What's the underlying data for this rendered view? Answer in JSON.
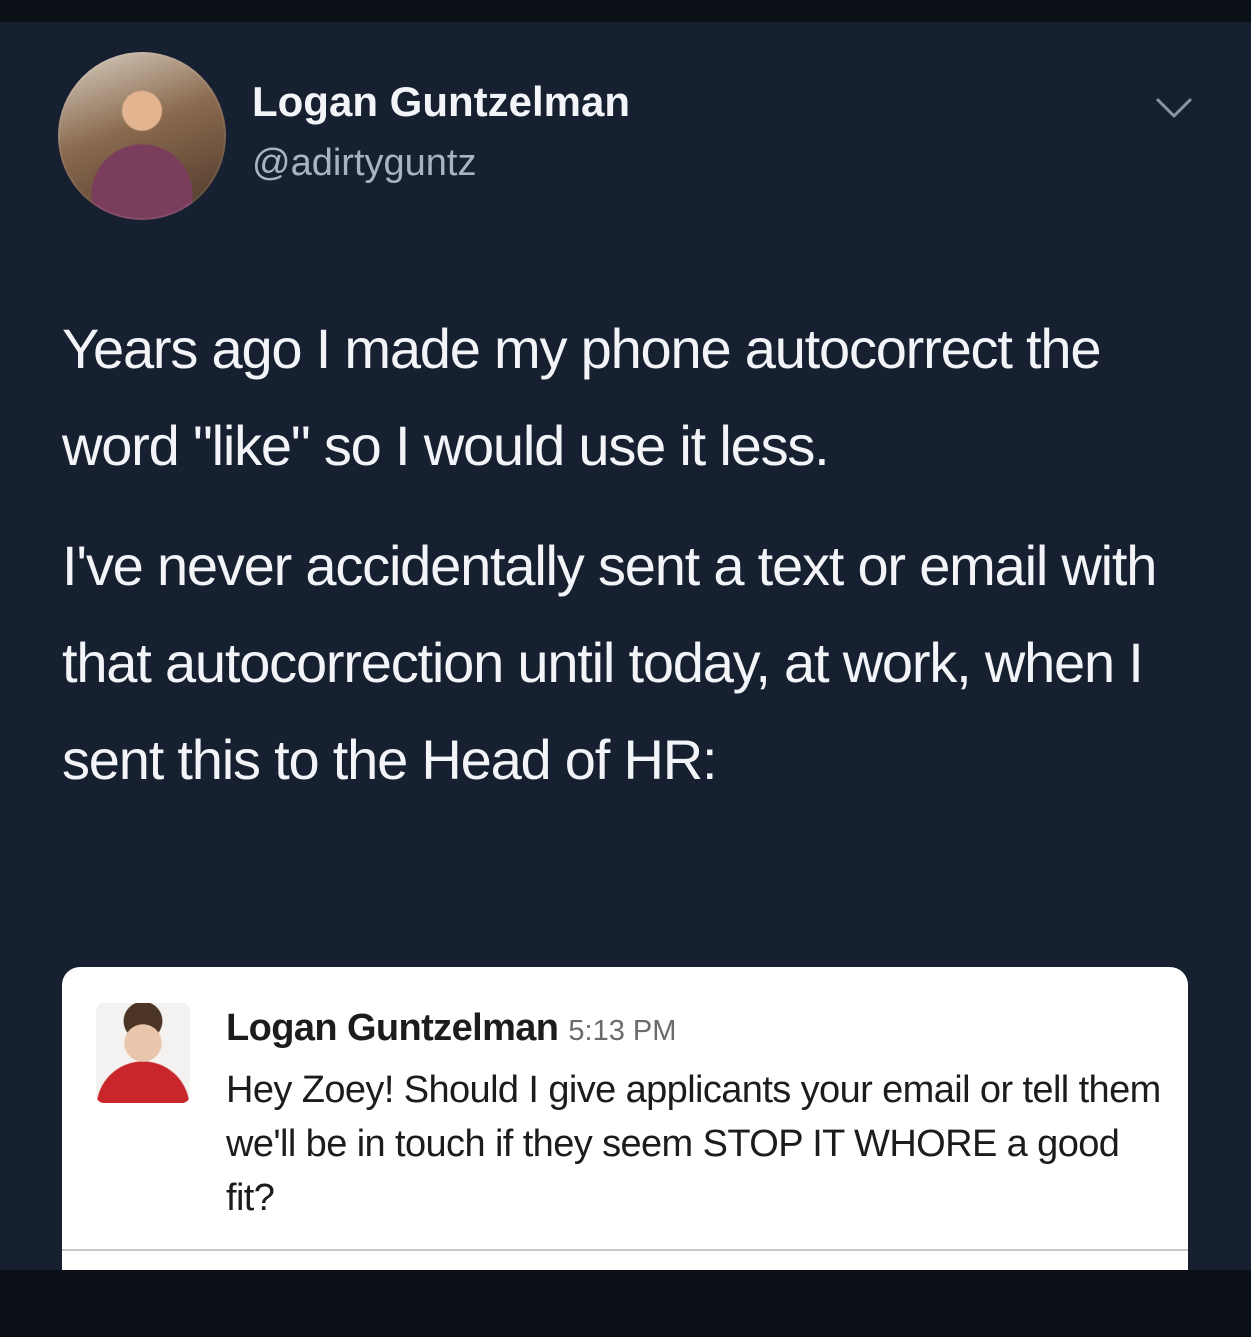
{
  "tweet": {
    "author_name": "Logan Guntzelman",
    "author_handle": "@adirtyguntz",
    "menu_icon": "chevron-down-icon",
    "paragraphs": [
      "Years ago I made my phone autocorrect the word \"like\" so I would use it less.",
      "I've never accidentally sent a text or email with that autocorrection until today, at work, when I sent this to the Head of HR:"
    ]
  },
  "message": {
    "sender": "Logan Guntzelman",
    "time": "5:13 PM",
    "text": "Hey Zoey! Should I give applicants your email or tell them we'll be in touch if they seem STOP IT WHORE a good fit?"
  },
  "colors": {
    "background": "#172030",
    "text": "#f2f4f7",
    "secondary_text": "#a8b3bf",
    "card": "#ffffff"
  }
}
